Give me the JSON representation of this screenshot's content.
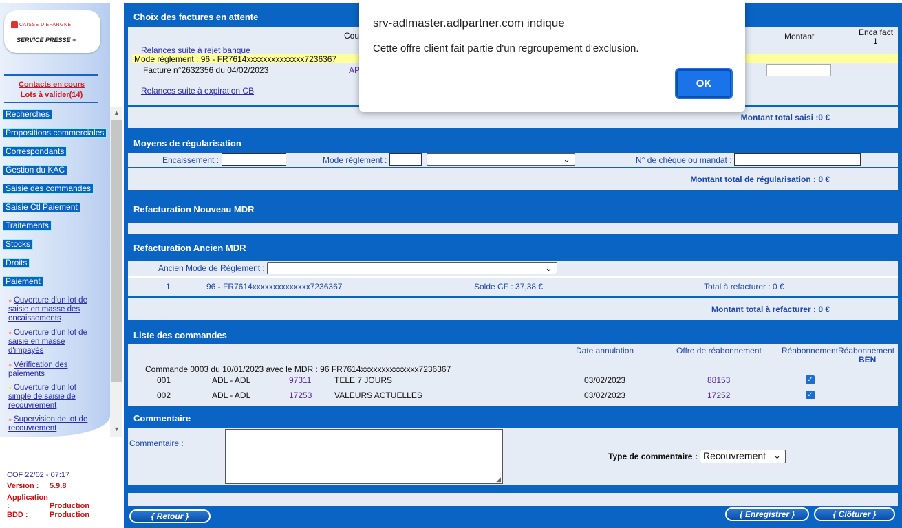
{
  "sidebar": {
    "logo_brand": "CAISSE D'EPARGNE",
    "logo_service": "SERVICE PRESSE +",
    "contacts": "Contacts en cours",
    "lots": "Lots à valider(14)",
    "menu": [
      "Recherches",
      "Propositions commerciales",
      "Correspondants",
      "Gestion du KAC",
      "Saisie des commandes",
      "Saisie Ctl Paiement",
      "Traitements",
      "Stocks",
      "Droits",
      "Paiement"
    ],
    "sub_links": [
      "Ouverture d'un lot de saisie en masse des encaissements",
      "Ouverture d'un lot de saisie en masse d'impayés",
      "Vérification des paiements",
      "Ouverture d'un lot simple de saisie de recouvrement",
      "Supervision de lot de recouvrement"
    ],
    "footer_cof": "COF 22/02 - 07:17",
    "version_label": "Version :",
    "version": "5.9.8",
    "application_label": "Application :",
    "application": "Production",
    "bdd_label": "BDD :",
    "bdd": "Production"
  },
  "factures": {
    "title": "Choix des factures en attente",
    "col_cou": "Cou",
    "col_montant": "Montant",
    "col_enca": "Enca fact",
    "col_enca_num": "1",
    "relances_rejet": "Relances suite à rejet banque",
    "mode_reglement": "Mode règlement : 96 - FR7614xxxxxxxxxxxxxx7236367",
    "facture": "Facture n°2632356 du 04/02/2023",
    "facture_link": "AP",
    "relances_cb": "Relances suite à expiration CB",
    "total": "Montant total saisi :0 €"
  },
  "regularisation": {
    "title": "Moyens de régularisation",
    "encaissement_label": "Encaissement :",
    "mode_label": "Mode règlement :",
    "cheque_label": "N° de chèque ou mandat :",
    "total": "Montant total de régularisation : 0 €"
  },
  "refact_nouveau": {
    "title": "Refacturation Nouveau MDR"
  },
  "refact_ancien": {
    "title": "Refacturation Ancien MDR",
    "ancien_label": "Ancien Mode de Règlement :",
    "row_num": "1",
    "row_mode": "96 - FR7614xxxxxxxxxxxxxx7236367",
    "row_solde": "Solde CF : 37,38 €",
    "row_total": "Total à refacturer : 0 €",
    "total": "Montant total à refacturer : 0 €"
  },
  "commandes": {
    "title": "Liste des commandes",
    "col_date": "Date annulation",
    "col_offre": "Offre de réabonnement",
    "col_reab": "Réabonnement",
    "col_reab_ben": "Réabonnement",
    "col_ben": "BEN",
    "commande_line": "Commande 0003 du 10/01/2023 avec le MDR : 96 FR7614xxxxxxxxxxxxxx7236367",
    "rows": [
      {
        "num": "001",
        "adl": "ADL - ADL",
        "code": "97311",
        "titre": "TELE 7 JOURS",
        "date": "03/02/2023",
        "offre": "88153",
        "checked": true
      },
      {
        "num": "002",
        "adl": "ADL - ADL",
        "code": "17253",
        "titre": "VALEURS ACTUELLES",
        "date": "03/02/2023",
        "offre": "17252",
        "checked": true
      }
    ]
  },
  "commentaire": {
    "title": "Commentaire",
    "label": "Commentaire :",
    "type_label": "Type de commentaire :",
    "type_value": "Recouvrement"
  },
  "buttons": {
    "retour": "{ Retour }",
    "enregistrer": "{ Enregistrer }",
    "cloturer": "{ Clôturer }"
  },
  "dialog": {
    "title": "srv-adlmaster.adlpartner.com indique",
    "message": "Cette offre client fait partie d'un regroupement d'exclusion.",
    "ok": "OK"
  },
  "colors": {
    "accent": "#0a64c4",
    "panel": "#e5ecf6",
    "highlight": "#ffff99",
    "alert_red": "#cc1111"
  }
}
